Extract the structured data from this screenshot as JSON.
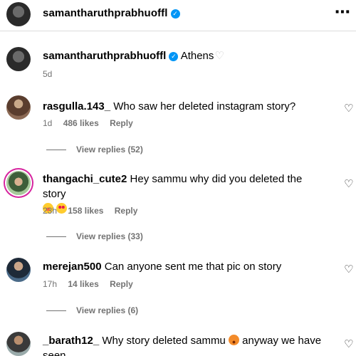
{
  "post_header": {
    "username": "samantharuthprabhuoffl",
    "more_icon": "more-horizontal-icon"
  },
  "caption": {
    "username": "samantharuthprabhuoffl",
    "text": "Athens",
    "time": "5d"
  },
  "comments": [
    {
      "username": "rasgulla.143_",
      "text": "Who saw her deleted instagram story?",
      "time": "1d",
      "likes": "486 likes",
      "reply": "Reply",
      "view_replies": "View replies (52)"
    },
    {
      "username": "thangachi_cute2",
      "text": "Hey sammu why did you deleted the story",
      "emojis": [
        "face-with-tears-of-joy",
        "smiling-face-with-heart-eyes"
      ],
      "time": "23h",
      "likes": "158 likes",
      "reply": "Reply",
      "view_replies": "View replies (33)"
    },
    {
      "username": "merejan500",
      "text": "Can anyone sent me that pic on story",
      "time": "17h",
      "likes": "14 likes",
      "reply": "Reply",
      "view_replies": "View replies (6)"
    },
    {
      "username": "_barath12_",
      "text_before": "Why story deleted sammu",
      "text_after": "anyway we have seen",
      "emojis": [
        "angry-face"
      ]
    }
  ],
  "colors": {
    "verified": "#0095f6",
    "meta_text": "#737373",
    "story_ring": "#d6249f"
  }
}
